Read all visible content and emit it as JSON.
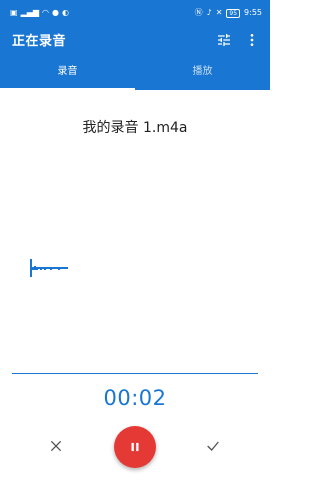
{
  "status_bar": {
    "left_icons": [
      "notification-icon",
      "signal-icon",
      "wifi-icon",
      "location-icon",
      "vpn-icon"
    ],
    "right_icons": [
      "nfc-icon",
      "mic-icon",
      "mute-icon"
    ],
    "battery": "95",
    "time": "9:55"
  },
  "app_bar": {
    "title": "正在录音",
    "actions": [
      "tune-icon",
      "more-vert-icon"
    ]
  },
  "tabs": [
    {
      "label": "录音",
      "selected": true
    },
    {
      "label": "播放",
      "selected": false
    }
  ],
  "recording": {
    "file_name": "我的录音 1.m4a",
    "timer": "00:02"
  },
  "controls": {
    "cancel": "close-icon",
    "pause": "pause-icon",
    "confirm": "check-icon"
  },
  "colors": {
    "primary": "#1976d2",
    "record_button": "#e53935"
  }
}
